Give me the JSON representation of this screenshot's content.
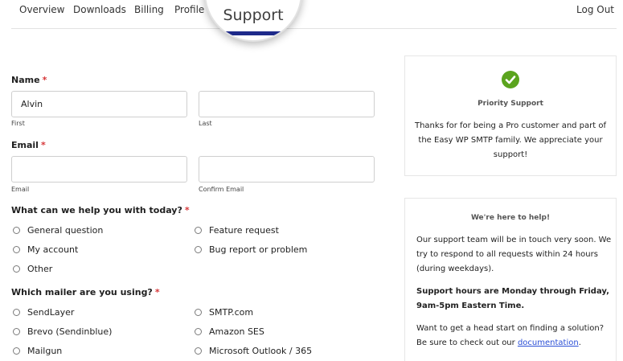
{
  "nav": {
    "items": [
      "Overview",
      "Downloads",
      "Billing",
      "Profile"
    ],
    "active": "Support",
    "logout": "Log Out"
  },
  "form": {
    "name": {
      "label": "Name",
      "required_mark": "*",
      "first_value": "Alvin",
      "first_label": "First",
      "last_label": "Last"
    },
    "email": {
      "label": "Email",
      "required_mark": "*",
      "email_label": "Email",
      "confirm_label": "Confirm Email"
    },
    "help": {
      "label": "What can we help you with today?",
      "required_mark": "*",
      "options": [
        "General question",
        "Feature request",
        "My account",
        "Bug report or problem",
        "Other"
      ]
    },
    "mailer": {
      "label": "Which mailer are you using?",
      "required_mark": "*",
      "options": [
        "SendLayer",
        "SMTP.com",
        "Brevo (Sendinblue)",
        "Amazon SES",
        "Mailgun",
        "Microsoft Outlook / 365"
      ]
    }
  },
  "priority_card": {
    "icon": "checkmark-circle-icon",
    "icon_color": "#5ba41e",
    "title": "Priority Support",
    "line1": "Thanks for for being a Pro customer and part of",
    "line2": "the Easy WP SMTP family. We appreciate your",
    "line3": "support!"
  },
  "help_card": {
    "title": "We're here to help!",
    "p1_l1": "Our support team will be in touch very soon. We",
    "p1_l2": "try to respond to all requests within 24 hours",
    "p1_l3": "(during weekdays).",
    "p2_l1": "Support hours are Monday through Friday,",
    "p2_l2": "9am-5pm Eastern Time.",
    "p3_l1": "Want to get a head start on finding a solution?",
    "p3_l2_prefix": "Be sure to check out our ",
    "p3_link": "documentation",
    "p3_suffix": "."
  },
  "colors": {
    "accent_bar": "#1e2a8a",
    "required": "#d63638",
    "link": "#2b4fd6"
  }
}
